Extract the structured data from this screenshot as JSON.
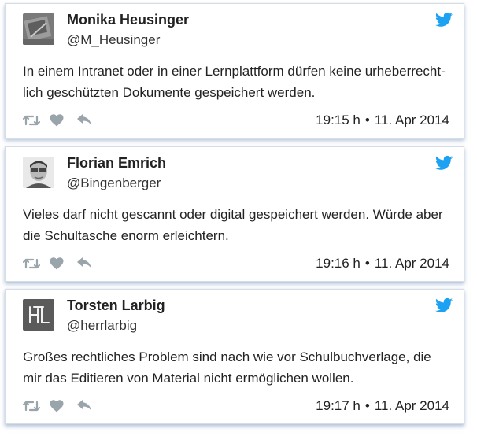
{
  "colors": {
    "twitter_blue": "#1da1f2",
    "icon_gray": "#9aa4ab"
  },
  "icons": [
    "twitter-bird-icon",
    "retweet-icon",
    "heart-icon",
    "reply-icon"
  ],
  "tweets": [
    {
      "name": "Monika Heusinger",
      "handle": "@M_Heusinger",
      "text": "In einem Intranet oder in einer Lernplattform dürfen keine urheberrecht-lich geschützten Dokumente gespeichert werden.",
      "time": "19:15 h",
      "separator": "•",
      "date": "11. Apr 2014"
    },
    {
      "name": "Florian Emrich",
      "handle": "@Bingenberger",
      "text": "Vieles darf nicht gescannt oder digital gespeichert werden. Würde aber die Schultasche enorm erleichtern.",
      "time": "19:16 h",
      "separator": "•",
      "date": "11. Apr 2014"
    },
    {
      "name": "Torsten Larbig",
      "handle": "@herrlarbig",
      "text": "Großes rechtliches Problem sind nach wie vor Schulbuchverlage, die mir das Editieren von Material nicht ermöglichen wollen.",
      "time": "19:17 h",
      "separator": "•",
      "date": "11. Apr 2014"
    }
  ]
}
